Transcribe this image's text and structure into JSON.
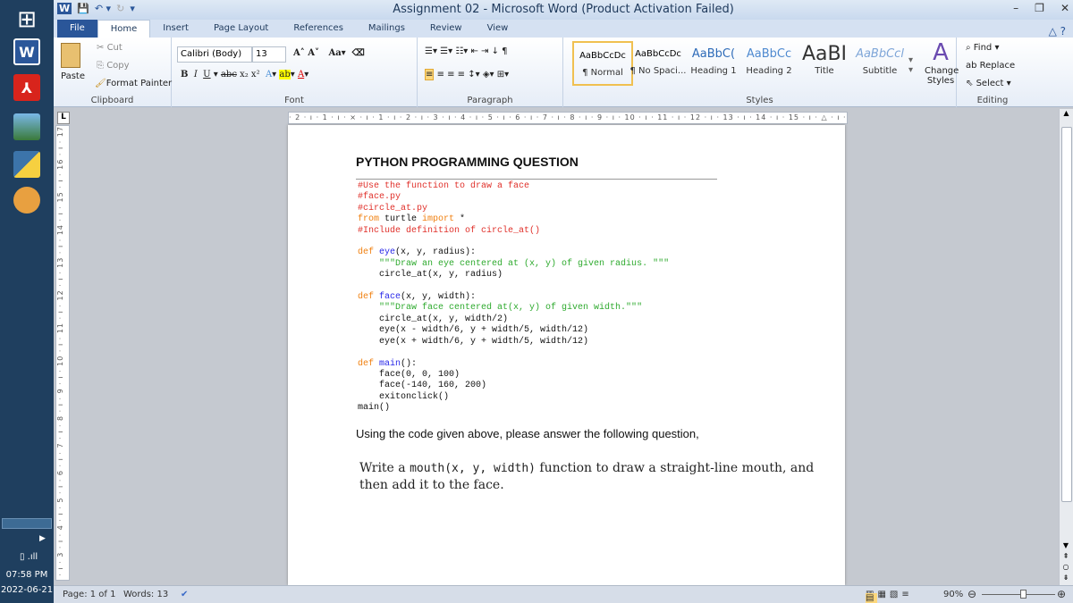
{
  "taskbar": {
    "apps": [
      "Word",
      "Acrobat",
      "Photos",
      "Python",
      "Paint"
    ],
    "time": "07:58 PM",
    "date": "2022-06-21"
  },
  "title": "Assignment 02  -  Microsoft Word (Product Activation Failed)",
  "tabs": [
    "File",
    "Home",
    "Insert",
    "Page Layout",
    "References",
    "Mailings",
    "Review",
    "View"
  ],
  "clipboard": {
    "paste": "Paste",
    "cut": "Cut",
    "copy": "Copy",
    "format_painter": "Format Painter",
    "label": "Clipboard"
  },
  "font": {
    "name": "Calibri (Body)",
    "size": "13",
    "label": "Font"
  },
  "paragraph": {
    "label": "Paragraph"
  },
  "styles": {
    "label": "Styles",
    "items": [
      {
        "preview": "AaBbCcDc",
        "name": "¶ Normal",
        "color": "#000"
      },
      {
        "preview": "AaBbCcDc",
        "name": "¶ No Spaci...",
        "color": "#000"
      },
      {
        "preview": "AaBbC(",
        "name": "Heading 1",
        "color": "#2e6bb8"
      },
      {
        "preview": "AaBbCc",
        "name": "Heading 2",
        "color": "#4f8ad0"
      },
      {
        "preview": "AaBI",
        "name": "Title",
        "color": "#333"
      },
      {
        "preview": "AaBbCcl",
        "name": "Subtitle",
        "color": "#7fa6d8"
      }
    ],
    "change": "Change Styles"
  },
  "editing": {
    "find": "Find",
    "replace": "Replace",
    "select": "Select",
    "label": "Editing"
  },
  "ruler": "· 2 · ı · 1 · ı · ⨯ · ı · 1 · ı · 2 · ı · 3 · ı · 4 · ı · 5 · ı · 6 · ı · 7 · ı · 8 · ı · 9 · ı · 10 · ı · 11 · ı · 12 · ı · 13 · ı · 14 · ı · 15 · ı · △ · ı · 17 · ı · 18 ·",
  "vruler": "· 1 · ı · 2 · ı · 3 · ı · 4 · ı · 5 · ı · 6 · ı · 7 · ı · 8 · ı · 9 · ı · 10 · ı · 11 · ı · 12 · ı · 13 · ı · 14 · ı · 15 · ı · 16 · ı · 17",
  "doc": {
    "heading": "PYTHON PROGRAMMING QUESTION",
    "code": [
      [
        [
          "#Use the function to draw a face",
          "c"
        ]
      ],
      [
        [
          "#face.py",
          "c"
        ]
      ],
      [
        [
          "#circle_at.py",
          "c"
        ]
      ],
      [
        [
          "from",
          "k"
        ],
        [
          " turtle ",
          ""
        ],
        [
          "import",
          "k"
        ],
        [
          " *",
          ""
        ]
      ],
      [
        [
          "#Include definition of circle_at()",
          "c"
        ]
      ],
      [
        [
          "",
          ""
        ]
      ],
      [
        [
          "def ",
          "k"
        ],
        [
          "eye",
          "f"
        ],
        [
          "(x, y, radius):",
          ""
        ]
      ],
      [
        [
          "    ",
          ""
        ],
        [
          "\"\"\"Draw an eye centered at (x, y) of given radius. \"\"\"",
          "s"
        ]
      ],
      [
        [
          "    circle_at(x, y, radius)",
          ""
        ]
      ],
      [
        [
          "",
          ""
        ]
      ],
      [
        [
          "def ",
          "k"
        ],
        [
          "face",
          "f"
        ],
        [
          "(x, y, width):",
          ""
        ]
      ],
      [
        [
          "    ",
          ""
        ],
        [
          "\"\"\"Draw face centered at(x, y) of given width.\"\"\"",
          "s"
        ]
      ],
      [
        [
          "    circle_at(x, y, width/2)",
          ""
        ]
      ],
      [
        [
          "    eye(x - width/6, y + width/5, width/12)",
          ""
        ]
      ],
      [
        [
          "    eye(x + width/6, y + width/5, width/12)",
          ""
        ]
      ],
      [
        [
          "",
          ""
        ]
      ],
      [
        [
          "def ",
          "k"
        ],
        [
          "main",
          "f"
        ],
        [
          "():",
          ""
        ]
      ],
      [
        [
          "    face(0, 0, 100)",
          ""
        ]
      ],
      [
        [
          "    face(-140, 160, 200)",
          ""
        ]
      ],
      [
        [
          "    exitonclick()",
          ""
        ]
      ],
      [
        [
          "main()",
          ""
        ]
      ]
    ],
    "question": "Using the code given above, please answer the following question,",
    "task_pre": "Write a ",
    "task_code": "mouth(x, y, width)",
    "task_post": " function to draw a straight-line mouth, and then add it to the face."
  },
  "status": {
    "page": "Page: 1 of 1",
    "words": "Words: 13",
    "zoom": "90%",
    "zoom_percent": 90
  }
}
